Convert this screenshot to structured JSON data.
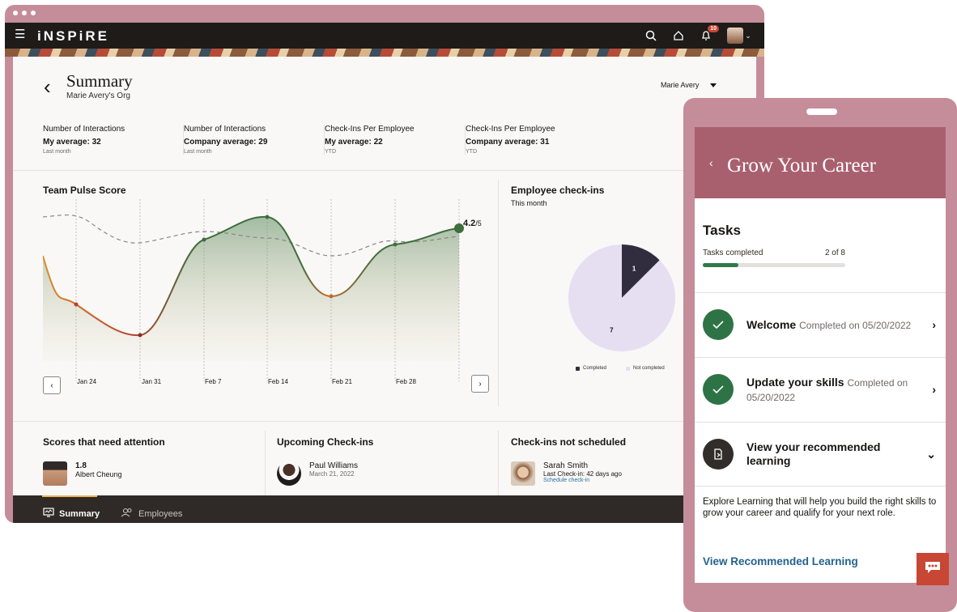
{
  "app": {
    "brand": "iNSPiRE",
    "notification_count": "10"
  },
  "summary": {
    "title": "Summary",
    "subtitle": "Marie Avery's Org",
    "user_select": "Marie Avery"
  },
  "stats": [
    {
      "label": "Number of Interactions",
      "value": "My average: 32",
      "period": "Last month"
    },
    {
      "label": "Number of Interactions",
      "value": "Company average: 29",
      "period": "Last month"
    },
    {
      "label": "Check-Ins Per Employee",
      "value": "My average: 22",
      "period": "YTD"
    },
    {
      "label": "Check-Ins Per Employee",
      "value": "Company average: 31",
      "period": "YTD"
    }
  ],
  "team_pulse": {
    "title": "Team Pulse Score",
    "score": "4.2",
    "score_denominator": "/5",
    "dates": [
      "Jan 24",
      "Jan 31",
      "Feb 7",
      "Feb 14",
      "Feb 21",
      "Feb 28"
    ]
  },
  "employee_checkins": {
    "title": "Employee check-ins",
    "subtitle": "This month",
    "completed": 1,
    "not_completed": 7,
    "legend_completed": "Completed",
    "legend_not_completed": "Not completed",
    "color_completed": "#312d3f",
    "color_not_completed": "#e6dff2"
  },
  "chart_data": {
    "type": "pie",
    "title": "Employee check-ins",
    "categories": [
      "Completed",
      "Not completed"
    ],
    "values": [
      1,
      7
    ]
  },
  "sections": {
    "attention": {
      "title": "Scores that need attention",
      "score": "1.8",
      "name": "Albert Cheung"
    },
    "upcoming": {
      "title": "Upcoming Check-ins",
      "name": "Paul Williams",
      "date": "March 21, 2022"
    },
    "not_scheduled": {
      "title": "Check-ins not scheduled",
      "name": "Sarah Smith",
      "last": "Last Check-in: 42 days ago",
      "link": "Schedule check-in"
    }
  },
  "bottom_nav": {
    "summary": "Summary",
    "employees": "Employees"
  },
  "mobile": {
    "title": "Grow Your Career",
    "tasks_heading": "Tasks",
    "tasks_completed_label": "Tasks completed",
    "tasks_completed_value": "2 of 8",
    "tasks_progress": 0.25,
    "task1_title": "Welcome",
    "task1_status": "Completed on 05/20/2022",
    "task2_title": "Update your skills",
    "task2_status": "Completed on 05/20/2022",
    "task3_title": "View your recommended learning",
    "explore_text": "Explore Learning that will help you build the right skills to grow your career and qualify for your next role.",
    "view_link": "View Recommended Learning"
  },
  "colors": {
    "frame": "#c58d99",
    "header_dark": "#1e1b19",
    "mobile_header": "#a9606e",
    "success": "#2e7346",
    "link": "#24628c",
    "chat": "#c74634"
  }
}
